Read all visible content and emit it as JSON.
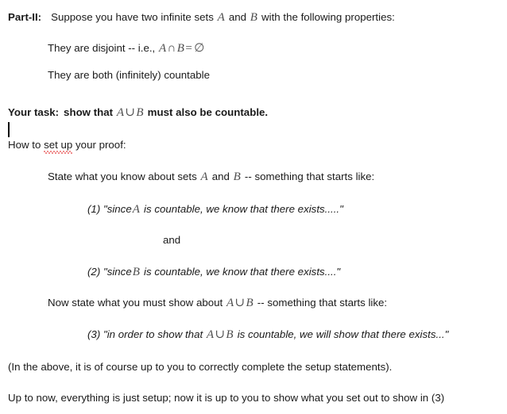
{
  "document": {
    "background_color": "#ffffff",
    "text_color": "#1a1a1a",
    "math_color": "#4d4d4d",
    "spellcheck_underline_color": "#e01b1b",
    "caret_visible": true
  },
  "part_heading": {
    "label": "Part-II:",
    "text_before_A": "Suppose you have two infinite sets",
    "math_A": "A",
    "text_between": "and",
    "math_B": "B",
    "text_after": "with the following properties:"
  },
  "properties": [
    {
      "id": "disjoint",
      "text_before": "They are disjoint -- i.e.,",
      "math": "A ∩ B = ∅",
      "math_parts": {
        "a": "A",
        "op1": "∩",
        "b": "B",
        "eq": "=",
        "empty": "∅"
      }
    },
    {
      "id": "countable",
      "text_before": "They are both (infinitely) countable",
      "math": "",
      "math_parts": null
    }
  ],
  "task": {
    "label": "Your task:",
    "text_before": "show that",
    "math": "A ∪ B",
    "math_parts": {
      "a": "A",
      "op1": "∪",
      "b": "B"
    },
    "text_after": "must also be countable."
  },
  "howto": {
    "prefix": "How to ",
    "misspelled": "set up",
    "suffix": " your proof:"
  },
  "instructions": {
    "state_know": {
      "text_before_A": "State what you know about sets",
      "math_A": "A",
      "text_between": "and",
      "math_B": "B",
      "text_after": "-- something that starts like:"
    },
    "item1": {
      "number": "(1)",
      "text_before": "\"since",
      "math": "A",
      "text_after": "is countable, we know that there exists.....\""
    },
    "conjunction": "and",
    "item2": {
      "number": "(2)",
      "text_before": "\"since",
      "math": "B",
      "text_after": "is countable, we know that there exists....\""
    },
    "state_show": {
      "text_before": "Now state what you must show about",
      "math": "A ∪ B",
      "math_parts": {
        "a": "A",
        "op1": "∪",
        "b": "B"
      },
      "text_after": "-- something that starts like:"
    },
    "item3": {
      "number": "(3)",
      "text_before": "\"in order to show that",
      "math": "A ∪ B",
      "math_parts": {
        "a": "A",
        "op1": "∪",
        "b": "B"
      },
      "text_after": "is countable, we will show that there exists...\""
    }
  },
  "notes": {
    "parenthetical": "(In the above, it is of course up to you to correctly complete the setup statements).",
    "closing": "Up to now, everything is just setup;  now it is up to you to show what you set out to show in (3)"
  }
}
